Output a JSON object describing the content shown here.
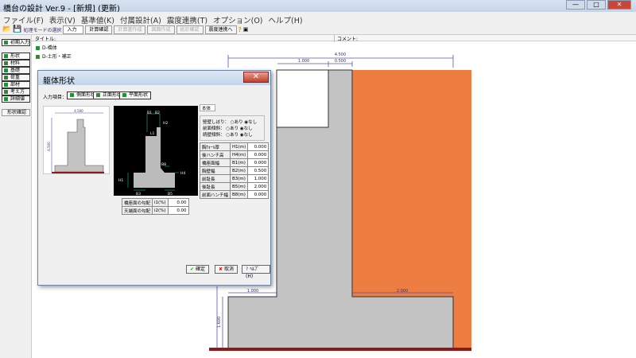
{
  "window": {
    "title": "橋台の設計 Ver.9 - [新規] (更新)",
    "buttons": [
      "—",
      "□",
      "✕"
    ]
  },
  "menu": [
    "ファイル(F)",
    "表示(V)",
    "基準値(K)",
    "付属設計(A)",
    "震度連携(T)",
    "オプション(O)",
    "ヘルプ(H)"
  ],
  "toolbar": {
    "mode_label": "処理モードの選択",
    "mode_value": "入力",
    "items": [
      {
        "label": "計算確認",
        "enabled": true
      },
      {
        "label": "計算書作成",
        "enabled": false
      },
      {
        "label": "図面作成",
        "enabled": false
      },
      {
        "label": "統計確認",
        "enabled": false
      },
      {
        "label": "震度連携へ",
        "enabled": true
      }
    ]
  },
  "sidebar": {
    "items": [
      "初期入力",
      "形状",
      "材料",
      "基礎",
      "荷重",
      "部材",
      "考え方",
      "詳細値"
    ],
    "extra": "形状確認"
  },
  "header": {
    "title_label": "タイトル:",
    "comment_label": "コメント:"
  },
  "tree": [
    "D-橋体",
    "D-土形・補正"
  ],
  "drawing": {
    "dims": {
      "top_total": "4.500",
      "top_left": "1.000",
      "top_right": "0.500",
      "bottom_left": "1.000",
      "bottom_right": "2.000",
      "height_left": "1.600"
    },
    "colors": {
      "body": "#c3c3c3",
      "fill": "#ee7d42",
      "base": "#8b1a1a"
    }
  },
  "dialog": {
    "title": "躯体形状",
    "input_label": "入力項目：",
    "tabs": [
      "側面形状",
      "正面形状",
      "平面形状"
    ],
    "thumb_dims": {
      "width": "4.500",
      "height": "6.500"
    },
    "diagram_labels": [
      "B1",
      "B2",
      "H2",
      "L1",
      "B8",
      "H4",
      "H1",
      "B3",
      "B5"
    ],
    "slope_table": [
      {
        "label": "橋座面の勾配",
        "sym": "i1(%)",
        "value": "0.00"
      },
      {
        "label": "天端面の勾配",
        "sym": "i2(%)",
        "value": "0.00"
      }
    ],
    "panel_tab": "本体",
    "radios": [
      {
        "label": "竪壁しぼり",
        "on": "あり",
        "off": "なし",
        "selected": "なし"
      },
      {
        "label": "前面傾斜",
        "on": "あり",
        "off": "なし",
        "selected": "なし"
      },
      {
        "label": "続壁傾斜",
        "on": "あり",
        "off": "なし",
        "selected": "なし"
      }
    ],
    "params": [
      {
        "label": "胸ｳｫｰﾙ厚",
        "sym": "H1(m)",
        "value": "0.000"
      },
      {
        "label": "後ハンチ高",
        "sym": "H4(m)",
        "value": "0.000"
      },
      {
        "label": "橋座面幅",
        "sym": "B1(m)",
        "value": "0.000"
      },
      {
        "label": "胸壁幅",
        "sym": "B2(m)",
        "value": "0.500"
      },
      {
        "label": "前趾長",
        "sym": "B3(m)",
        "value": "1.000"
      },
      {
        "label": "後趾長",
        "sym": "B5(m)",
        "value": "2.000"
      },
      {
        "label": "前面ハンチ幅",
        "sym": "B8(m)",
        "value": "0.000"
      }
    ],
    "buttons": {
      "ok": "確定",
      "cancel": "取消",
      "help": "ﾍﾙﾌﾟ(H)"
    }
  }
}
